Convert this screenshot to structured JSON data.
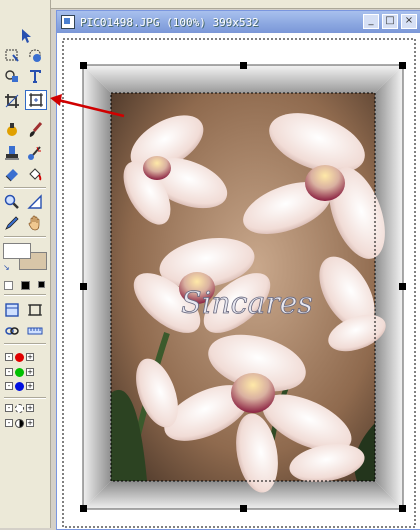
{
  "window": {
    "title": "PIC01498.JPG (100%) 399x532",
    "minimize_label": "_",
    "maximize_label": "□",
    "close_label": "×"
  },
  "toolbox": {
    "tools": [
      {
        "name": "selection-arrow-icon"
      },
      {
        "name": "selection-rect-icon"
      },
      {
        "name": "freehand-select-icon"
      },
      {
        "name": "magic-wand-icon"
      },
      {
        "name": "shapes-icon"
      },
      {
        "name": "text-tool-icon"
      },
      {
        "name": "crop-tool-icon"
      },
      {
        "name": "deformation-tool-icon"
      },
      {
        "name": "dropper-icon"
      },
      {
        "name": "paintbrush-icon"
      },
      {
        "name": "clone-brush-icon"
      },
      {
        "name": "retouch-icon"
      },
      {
        "name": "eraser-icon"
      },
      {
        "name": "flood-fill-icon"
      },
      {
        "name": "zoom-icon"
      },
      {
        "name": "line-tool-icon"
      },
      {
        "name": "pen-icon"
      },
      {
        "name": "pan-hand-icon"
      }
    ],
    "foreground_color": "#ffffff",
    "background_color": "#d8c6a8",
    "channel_colors": [
      "#e00000",
      "#00c000",
      "#0010e0"
    ]
  },
  "image": {
    "watermark": "Sincares",
    "frame_color": "#c8c8c8",
    "marquee": "dashed"
  },
  "annotation": {
    "arrow_color": "#d00000",
    "points_to": "deformation-tool-icon"
  }
}
